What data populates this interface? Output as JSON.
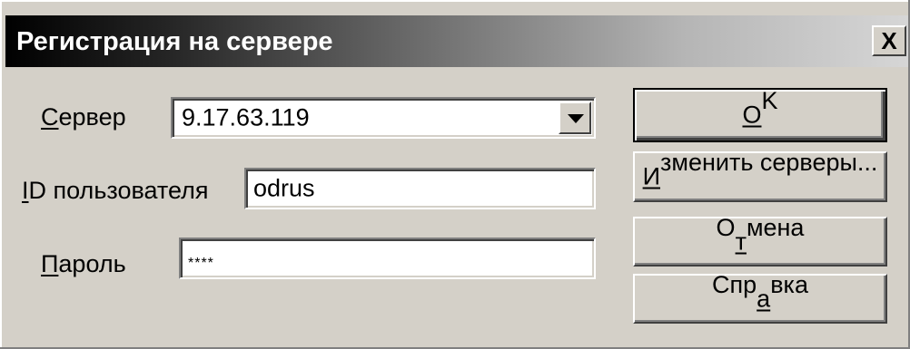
{
  "dialog": {
    "title": "Регистрация на сервере",
    "close_label": "X"
  },
  "server": {
    "label_mnemonic": "С",
    "label_rest": "ервер",
    "value": "9.17.63.119"
  },
  "user_id": {
    "label_mnemonic": "I",
    "label_rest": "D пользователя",
    "value": "odrus"
  },
  "password": {
    "label_mnemonic": "П",
    "label_rest": "ароль",
    "value": "****"
  },
  "buttons": {
    "ok": {
      "mnemonic": "O",
      "rest": "K"
    },
    "change_servers": {
      "mnemonic": "И",
      "rest": "зменить серверы..."
    },
    "cancel": {
      "before": "О",
      "mnemonic": "т",
      "rest": "мена"
    },
    "help": {
      "before": "Спр",
      "mnemonic": "а",
      "rest": "вка"
    }
  },
  "icons": {
    "close": "close-icon",
    "dropdown": "chevron-down-icon"
  },
  "colors": {
    "face": "#d4d0c8",
    "title_start": "#000000",
    "title_end": "#d6d6d6"
  }
}
